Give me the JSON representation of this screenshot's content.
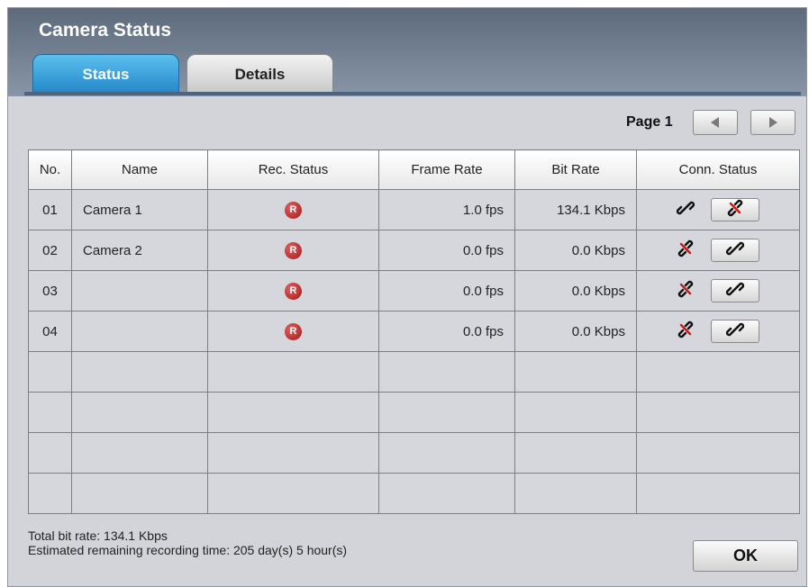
{
  "window": {
    "title": "Camera Status"
  },
  "tabs": [
    {
      "label": "Status",
      "active": true
    },
    {
      "label": "Details",
      "active": false
    }
  ],
  "pager": {
    "label": "Page 1"
  },
  "table": {
    "headers": [
      "No.",
      "Name",
      "Rec. Status",
      "Frame Rate",
      "Bit Rate",
      "Conn. Status"
    ],
    "rows": [
      {
        "no": "01",
        "name": "Camera 1",
        "rec": "R",
        "frame_rate": "1.0 fps",
        "bit_rate": "134.1 Kbps",
        "connected": true
      },
      {
        "no": "02",
        "name": "Camera 2",
        "rec": "R",
        "frame_rate": "0.0 fps",
        "bit_rate": "0.0 Kbps",
        "connected": false
      },
      {
        "no": "03",
        "name": "",
        "rec": "R",
        "frame_rate": "0.0 fps",
        "bit_rate": "0.0 Kbps",
        "connected": false
      },
      {
        "no": "04",
        "name": "",
        "rec": "R",
        "frame_rate": "0.0 fps",
        "bit_rate": "0.0 Kbps",
        "connected": false
      }
    ],
    "empty_rows": 4
  },
  "footer": {
    "total_bit_rate": "Total bit rate: 134.1 Kbps",
    "remaining_time": "Estimated remaining recording time: 205 day(s) 5 hour(s)",
    "ok_label": "OK"
  },
  "icons": {
    "rec": "record-icon",
    "connected": "link-icon",
    "disconnected": "broken-link-icon",
    "prev": "arrow-left-icon",
    "next": "arrow-right-icon"
  },
  "colors": {
    "tab_active": "#2386c9",
    "rec_badge": "#a11818",
    "title_bar": "#5d6a7b"
  }
}
